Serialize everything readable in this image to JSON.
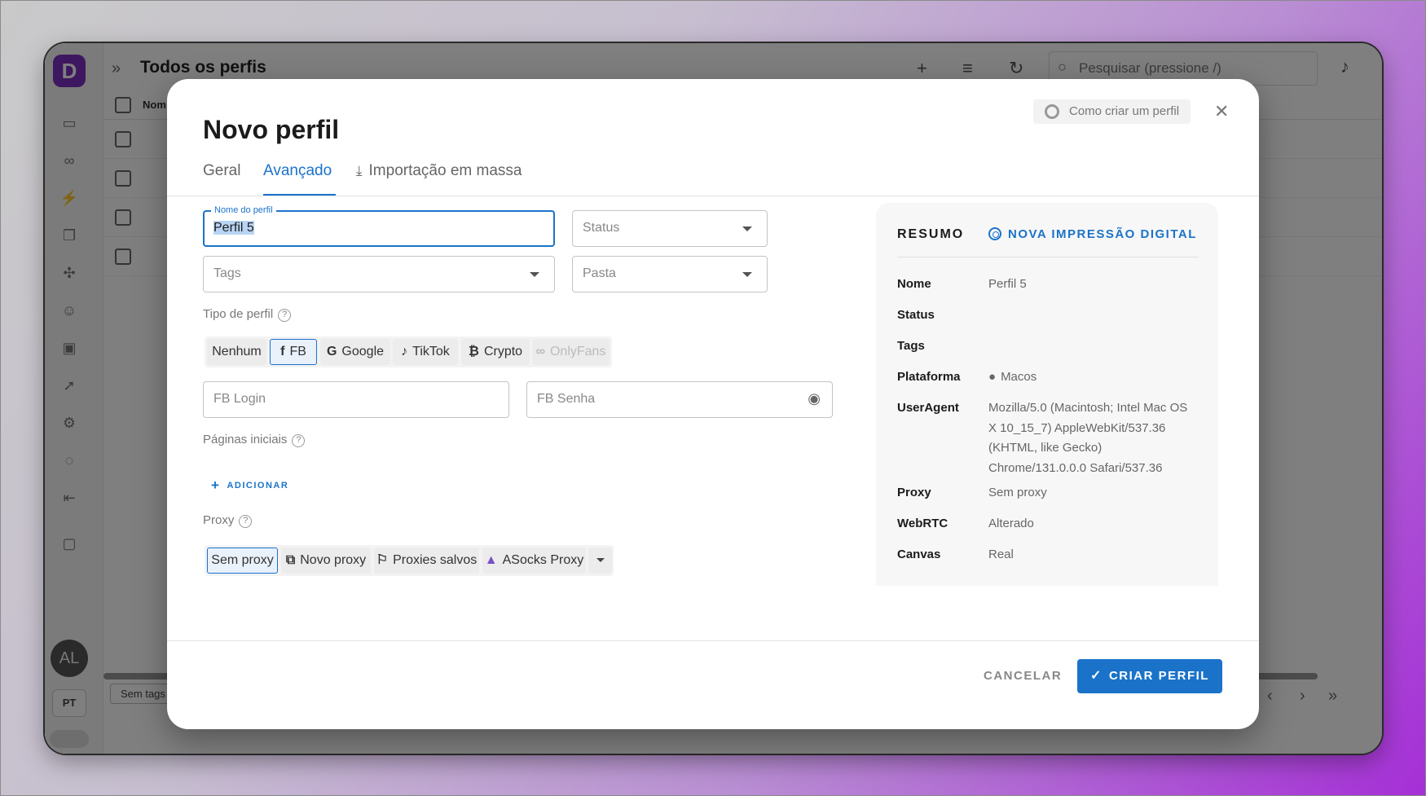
{
  "background_app": {
    "title": "Todos os perfis",
    "search_placeholder": "Pesquisar (pressione /)",
    "column_name": "Nom",
    "avatar_initials": "AL",
    "language": "PT",
    "tag_filter": "Sem tags",
    "logo_letter": "D"
  },
  "modal": {
    "title": "Novo perfil",
    "help_button": "Como criar um perfil",
    "tabs": [
      {
        "label": "Geral"
      },
      {
        "label": "Avançado"
      },
      {
        "label": "Importação em massa"
      }
    ],
    "active_tab": "Avançado",
    "fields": {
      "profile_name_label": "Nome do perfil",
      "profile_name_value": "Perfil 5",
      "status_placeholder": "Status",
      "tags_placeholder": "Tags",
      "folder_placeholder": "Pasta"
    },
    "profile_type": {
      "label": "Tipo de perfil",
      "options": [
        {
          "label": "Nenhum",
          "icon": ""
        },
        {
          "label": "FB",
          "icon": "facebook-icon"
        },
        {
          "label": "Google",
          "icon": "google-icon"
        },
        {
          "label": "TikTok",
          "icon": "tiktok-icon"
        },
        {
          "label": "Crypto",
          "icon": "bitcoin-icon"
        },
        {
          "label": "OnlyFans",
          "icon": "onlyfans-icon"
        }
      ],
      "selected": "FB",
      "disabled": "OnlyFans"
    },
    "fb_login_placeholder": "FB Login",
    "fb_password_placeholder": "FB Senha",
    "start_pages": {
      "label": "Páginas iniciais",
      "add_label": "ADICIONAR"
    },
    "proxy": {
      "label": "Proxy",
      "options": [
        {
          "label": "Sem proxy",
          "icon": ""
        },
        {
          "label": "Novo proxy",
          "icon": "new-proxy-icon"
        },
        {
          "label": "Proxies salvos",
          "icon": "bookmark-icon"
        },
        {
          "label": "ASocks Proxy",
          "icon": "asocks-icon"
        }
      ],
      "selected": "Sem proxy"
    },
    "summary": {
      "title": "RESUMO",
      "new_fingerprint": "NOVA IMPRESSÃO DIGITAL",
      "rows": [
        {
          "key": "Nome",
          "value": "Perfil 5"
        },
        {
          "key": "Status",
          "value": ""
        },
        {
          "key": "Tags",
          "value": ""
        },
        {
          "key": "Plataforma",
          "value": "Macos"
        },
        {
          "key": "UserAgent",
          "value": "Mozilla/5.0 (Macintosh; Intel Mac OS X 10_15_7) AppleWebKit/537.36 (KHTML, like Gecko) Chrome/131.0.0.0 Safari/537.36"
        },
        {
          "key": "Proxy",
          "value": "Sem proxy"
        },
        {
          "key": "WebRTC",
          "value": "Alterado"
        },
        {
          "key": "Canvas",
          "value": "Real"
        }
      ]
    },
    "buttons": {
      "cancel": "CANCELAR",
      "create": "CRIAR PERFIL"
    }
  },
  "colors": {
    "accent": "#1a73c9",
    "brand": "#7a2fc0"
  }
}
